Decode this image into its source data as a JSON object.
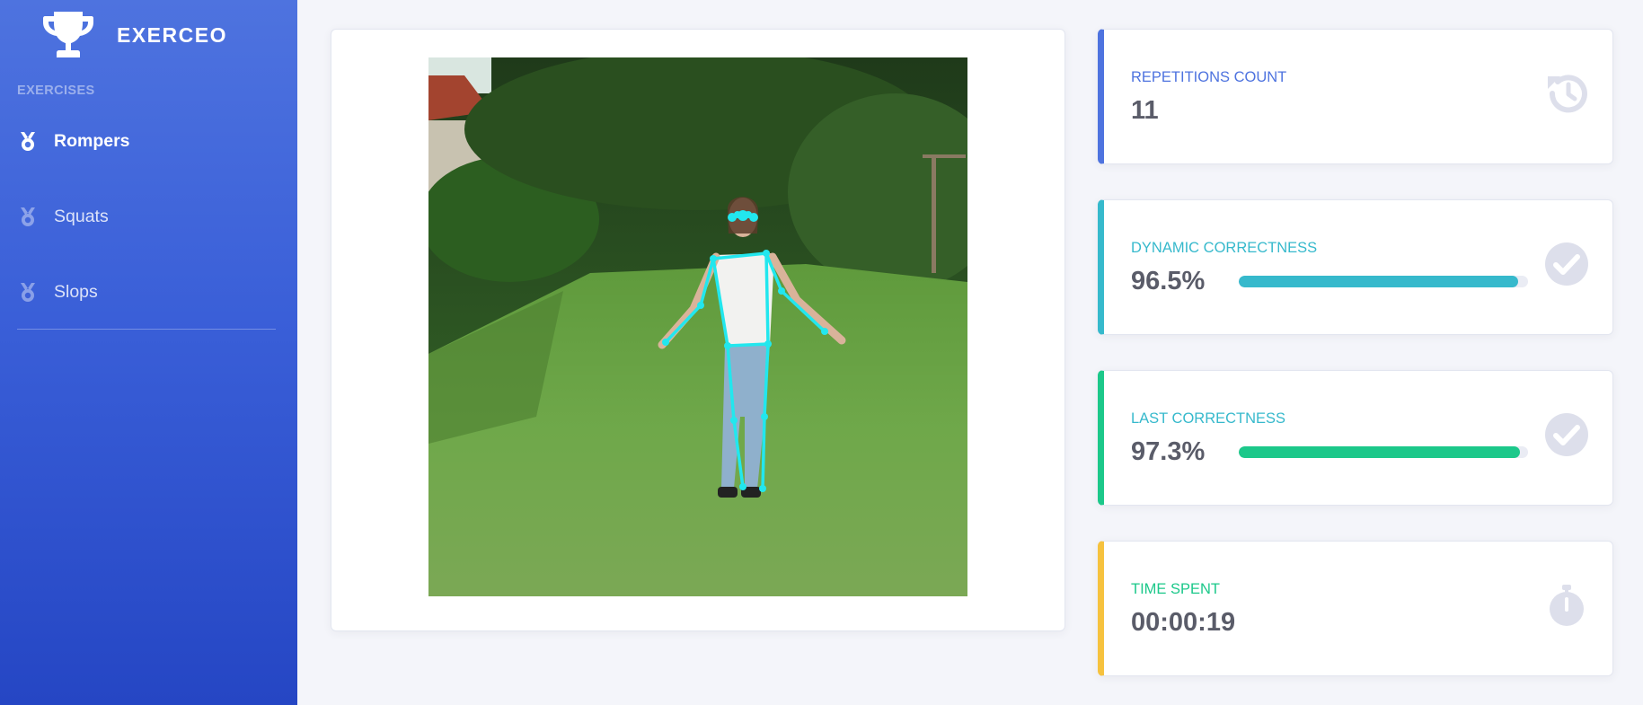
{
  "app": {
    "name": "EXERCEO"
  },
  "sidebar": {
    "heading": "EXERCISES",
    "items": [
      {
        "label": "Rompers",
        "icon": "medal-icon",
        "active": true
      },
      {
        "label": "Squats",
        "icon": "medal-icon",
        "active": false
      },
      {
        "label": "Slops",
        "icon": "medal-icon",
        "active": false
      }
    ]
  },
  "video": {
    "description_icon": "pose-skeleton-overlay",
    "skeleton_color": "#22e7ee"
  },
  "stats": [
    {
      "label": "REPETITIONS COUNT",
      "value": "11",
      "icon": "history-icon",
      "accent": "#4e73df"
    },
    {
      "label": "DYNAMIC CORRECTNESS",
      "value": "96.5%",
      "progress": 0.965,
      "icon": "check-circle-icon",
      "accent": "#36b9cc"
    },
    {
      "label": "LAST CORRECTNESS",
      "value": "97.3%",
      "progress": 0.973,
      "icon": "check-circle-icon",
      "accent": "#1cc88a"
    },
    {
      "label": "TIME SPENT",
      "value": "00:00:19",
      "icon": "stopwatch-icon",
      "accent": "#f6c23e"
    }
  ],
  "colors": {
    "primary": "#4e73df",
    "info": "#36b9cc",
    "success": "#1cc88a",
    "warning": "#f6c23e",
    "icon_muted": "#dddfeb"
  }
}
